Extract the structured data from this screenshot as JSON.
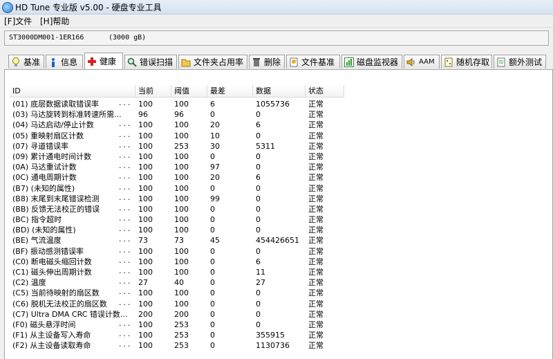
{
  "window": {
    "title": "HD Tune 专业版 v5.00 - 硬盘专业工具"
  },
  "menu": [
    {
      "label": "[F]文件"
    },
    {
      "label": "[H]帮助"
    }
  ],
  "drive": {
    "model": "ST3000DM001-1ER166",
    "size": "(3000 gB)"
  },
  "tabs": [
    {
      "label": "基准",
      "icon": "bulb-icon"
    },
    {
      "label": "信息",
      "icon": "info-icon"
    },
    {
      "label": "健康",
      "icon": "red-cross-icon",
      "active": true
    },
    {
      "label": "错误扫描",
      "icon": "magnifier-icon"
    },
    {
      "label": "文件夹占用率",
      "icon": "folder-icon"
    },
    {
      "label": "删除",
      "icon": "trash-icon"
    },
    {
      "label": "文件基准",
      "icon": "file-bulb-icon"
    },
    {
      "label": "磁盘监视器",
      "icon": "chart-icon"
    },
    {
      "label": "AAM",
      "icon": "speaker-icon"
    },
    {
      "label": "随机存取",
      "icon": "random-icon"
    },
    {
      "label": "额外测试",
      "icon": "extra-test-icon"
    }
  ],
  "table": {
    "headers": [
      "ID",
      "当前",
      "阈值",
      "最差",
      "数据",
      "状态"
    ],
    "rows": [
      {
        "id": "(01) 底层数据读取错误率",
        "dots": "...",
        "current": "100",
        "threshold": "100",
        "worst": "6",
        "data": "1055736",
        "status": "正常"
      },
      {
        "id": "(03) 马达旋转到标准转速所需...",
        "dots": "",
        "current": "96",
        "threshold": "96",
        "worst": "0",
        "data": "0",
        "status": "正常"
      },
      {
        "id": "(04) 马达启动/停止计数",
        "dots": "...",
        "current": "100",
        "threshold": "100",
        "worst": "20",
        "data": "6",
        "status": "正常"
      },
      {
        "id": "(05) 重映射扇区计数",
        "dots": "...",
        "current": "100",
        "threshold": "100",
        "worst": "10",
        "data": "0",
        "status": "正常"
      },
      {
        "id": "(07) 寻道错误率",
        "dots": "...",
        "current": "100",
        "threshold": "253",
        "worst": "30",
        "data": "5311",
        "status": "正常"
      },
      {
        "id": "(09) 累计通电时间计数",
        "dots": "...",
        "current": "100",
        "threshold": "100",
        "worst": "0",
        "data": "0",
        "status": "正常"
      },
      {
        "id": "(0A) 马达重试计数",
        "dots": "...",
        "current": "100",
        "threshold": "100",
        "worst": "97",
        "data": "0",
        "status": "正常"
      },
      {
        "id": "(0C) 通电周期计数",
        "dots": "...",
        "current": "100",
        "threshold": "100",
        "worst": "20",
        "data": "6",
        "status": "正常"
      },
      {
        "id": "(B7) (未知的属性)",
        "dots": "...",
        "current": "100",
        "threshold": "100",
        "worst": "0",
        "data": "0",
        "status": "正常"
      },
      {
        "id": "(B8) 末尾到末尾错误检测",
        "dots": "...",
        "current": "100",
        "threshold": "100",
        "worst": "99",
        "data": "0",
        "status": "正常"
      },
      {
        "id": "(BB) 反馈无法校正的错误",
        "dots": "...",
        "current": "100",
        "threshold": "100",
        "worst": "0",
        "data": "0",
        "status": "正常"
      },
      {
        "id": "(BC) 指令超时",
        "dots": "...",
        "current": "100",
        "threshold": "100",
        "worst": "0",
        "data": "0",
        "status": "正常"
      },
      {
        "id": "(BD) (未知的属性)",
        "dots": "...",
        "current": "100",
        "threshold": "100",
        "worst": "0",
        "data": "0",
        "status": "正常"
      },
      {
        "id": "(BE) 气流温度",
        "dots": "...",
        "current": "73",
        "threshold": "73",
        "worst": "45",
        "data": "454426651",
        "status": "正常"
      },
      {
        "id": "(BF) 振动感测错误率",
        "dots": "...",
        "current": "100",
        "threshold": "100",
        "worst": "0",
        "data": "0",
        "status": "正常"
      },
      {
        "id": "(C0) 断电磁头缩回计数",
        "dots": "...",
        "current": "100",
        "threshold": "100",
        "worst": "0",
        "data": "6",
        "status": "正常"
      },
      {
        "id": "(C1) 磁头伸出周期计数",
        "dots": "...",
        "current": "100",
        "threshold": "100",
        "worst": "0",
        "data": "11",
        "status": "正常"
      },
      {
        "id": "(C2) 温度",
        "dots": "...",
        "current": "27",
        "threshold": "40",
        "worst": "0",
        "data": "27",
        "status": "正常"
      },
      {
        "id": "(C5) 当前待映射的扇区数",
        "dots": "...",
        "current": "100",
        "threshold": "100",
        "worst": "0",
        "data": "0",
        "status": "正常"
      },
      {
        "id": "(C6) 脱机无法校正的扇区数",
        "dots": "...",
        "current": "100",
        "threshold": "100",
        "worst": "0",
        "data": "0",
        "status": "正常"
      },
      {
        "id": "(C7) Ultra DMA CRC 错误计数...",
        "dots": "",
        "current": "200",
        "threshold": "200",
        "worst": "0",
        "data": "0",
        "status": "正常"
      },
      {
        "id": "(F0) 磁头悬浮时间",
        "dots": "...",
        "current": "100",
        "threshold": "253",
        "worst": "0",
        "data": "0",
        "status": "正常"
      },
      {
        "id": "(F1) 从主设备写入寿命",
        "dots": "...",
        "current": "100",
        "threshold": "253",
        "worst": "0",
        "data": "355915",
        "status": "正常"
      },
      {
        "id": "(F2) 从主设备读取寿命",
        "dots": "...",
        "current": "100",
        "threshold": "253",
        "worst": "0",
        "data": "1130736",
        "status": "正常"
      }
    ]
  }
}
